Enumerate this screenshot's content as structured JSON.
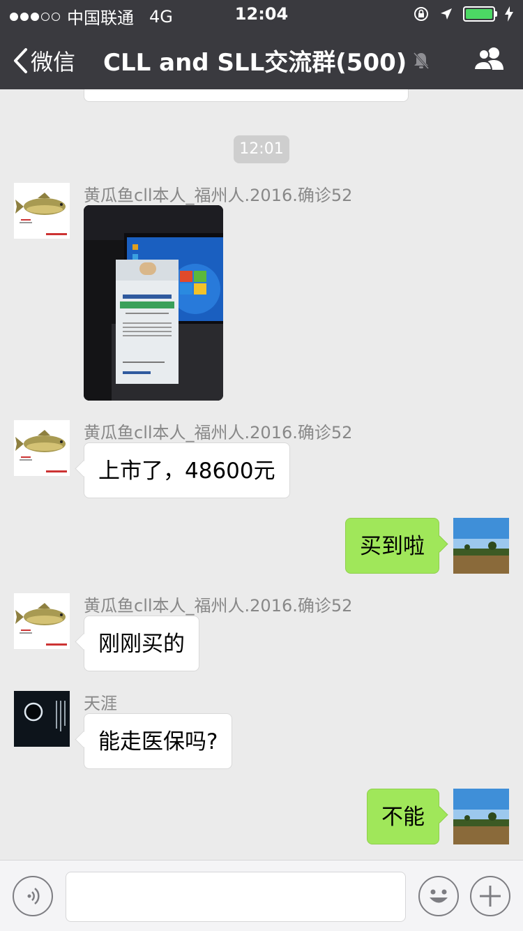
{
  "status_bar": {
    "carrier": "中国联通",
    "network": "4G",
    "time": "12:04"
  },
  "nav": {
    "back_label": "微信",
    "title": "CLL and SLL交流群(500)"
  },
  "chat": {
    "timestamp": "12:01",
    "messages": [
      {
        "sender": "黄瓜鱼cll本人_福州人.2016.确诊52",
        "type": "image",
        "direction": "in"
      },
      {
        "sender": "黄瓜鱼cll本人_福州人.2016.确诊52",
        "type": "text",
        "direction": "in",
        "text": "上市了，48600元"
      },
      {
        "sender": "",
        "type": "text",
        "direction": "out",
        "text": "买到啦"
      },
      {
        "sender": "黄瓜鱼cll本人_福州人.2016.确诊52",
        "type": "text",
        "direction": "in",
        "text": "刚刚买的"
      },
      {
        "sender": "天涯",
        "type": "text",
        "direction": "in",
        "text": "能走医保吗?"
      },
      {
        "sender": "",
        "type": "text",
        "direction": "out",
        "text": "不能"
      }
    ]
  },
  "input_bar": {
    "value": "",
    "placeholder": ""
  },
  "icons": [
    "signal-dots-icon",
    "lock-rotation-icon",
    "location-arrow-icon",
    "battery-icon",
    "charging-icon",
    "back-chevron-icon",
    "mute-bell-icon",
    "group-members-icon",
    "voice-icon",
    "emoji-icon",
    "plus-icon"
  ],
  "colors": {
    "nav_bg": "#3a3a3f",
    "chat_bg": "#ebebeb",
    "outgoing_bubble": "#a0e75a",
    "incoming_bubble": "#ffffff",
    "battery": "#4cd964"
  }
}
